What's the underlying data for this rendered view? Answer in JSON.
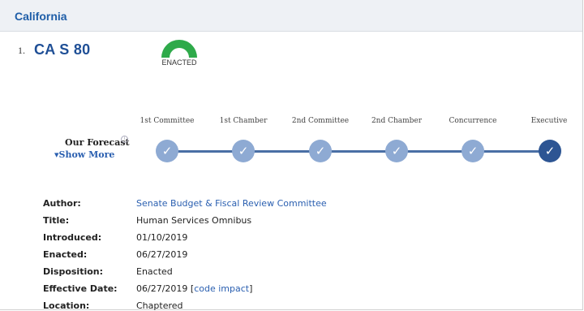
{
  "region": {
    "title": "California"
  },
  "bill": {
    "number": "1.",
    "title": "CA S 80",
    "status_badge": "ENACTED",
    "status_color": "#2eaa4a"
  },
  "forecast": {
    "label": "Our Forecast",
    "show_more": "▾Show More",
    "info_icon": "info-icon",
    "stages": [
      "1st Committee",
      "1st Chamber",
      "2nd Committee",
      "2nd Chamber",
      "Concurrence",
      "Executive"
    ],
    "check_glyph": "✓",
    "completed_color": "#8eaad3",
    "final_color": "#2d5593"
  },
  "details": {
    "author_label": "Author:",
    "author_value": "Senate Budget & Fiscal Review Committee",
    "title_label": "Title:",
    "title_value": "Human Services Omnibus",
    "introduced_label": "Introduced:",
    "introduced_value": "01/10/2019",
    "enacted_label": "Enacted:",
    "enacted_value": "06/27/2019",
    "disposition_label": "Disposition:",
    "disposition_value": "Enacted",
    "effective_label": "Effective Date:",
    "effective_value": "06/27/2019",
    "code_impact_open": "[",
    "code_impact_link": "code impact",
    "code_impact_close": "]",
    "location_label": "Location:",
    "location_value": "Chaptered"
  }
}
